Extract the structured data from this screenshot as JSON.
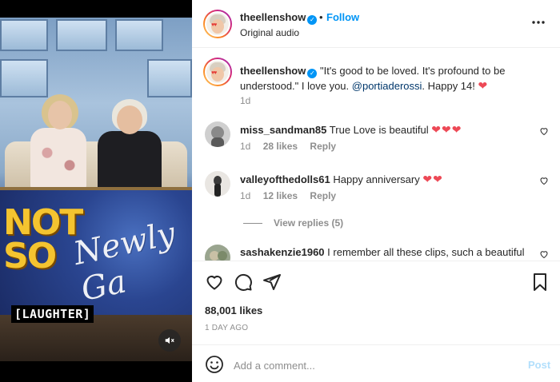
{
  "post": {
    "media": {
      "show_title_line1": "NOT",
      "show_title_line2": "SO",
      "show_script": "Newly Ga",
      "caption_tag": "[LAUGHTER]",
      "mute_icon": "speaker-muted-icon"
    },
    "header": {
      "username": "theellenshow",
      "follow_label": "Follow",
      "dot": "•",
      "audio": "Original audio",
      "more_icon": "more-horizontal-icon"
    },
    "caption": {
      "username": "theellenshow",
      "text_before": "\"It's good to be loved. It's profound to be understood.\" I love you. ",
      "mention": "@portiaderossi",
      "text_after": ". Happy 14! ",
      "heart": "❤",
      "time": "1d"
    },
    "comments": [
      {
        "username": "miss_sandman85",
        "text": "True Love is beautiful",
        "hearts": "❤❤❤",
        "time": "1d",
        "likes": "28 likes",
        "reply": "Reply"
      },
      {
        "username": "valleyofthedolls61",
        "text": "Happy anniversary",
        "hearts": "❤❤",
        "time": "1d",
        "likes": "12 likes",
        "reply": "Reply"
      },
      {
        "username": "sashakenzie1960",
        "text": "I remember all these clips, such a beautiful"
      }
    ],
    "view_replies": "View replies (5)",
    "likes": "88,001 likes",
    "date": "1 DAY AGO",
    "add_comment": {
      "placeholder": "Add a comment...",
      "post_label": "Post"
    },
    "colors": {
      "link": "#0095f6",
      "heart": "#ed4956",
      "muted": "#8e8e8e",
      "post_disabled": "#b2dffc"
    }
  }
}
